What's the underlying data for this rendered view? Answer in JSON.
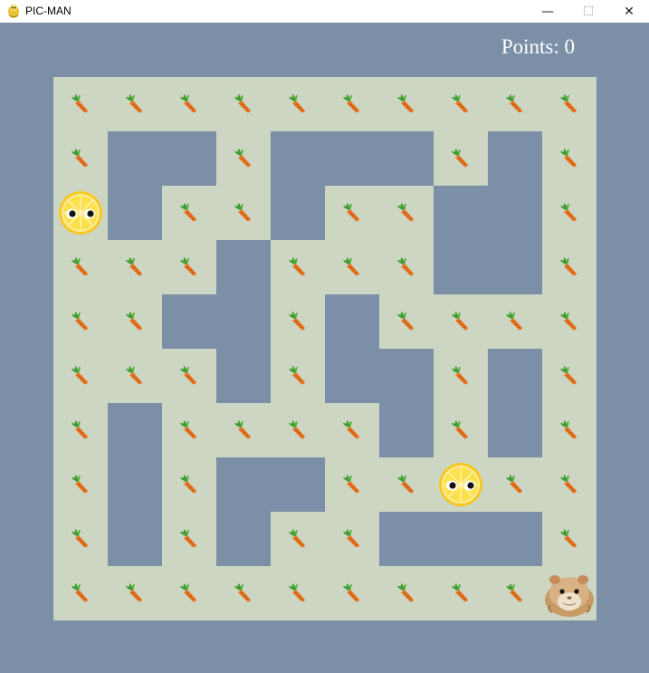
{
  "window": {
    "title": "PIC-MAN",
    "controls": {
      "minimize": "—",
      "maximize": "☐",
      "close": "✕"
    }
  },
  "game": {
    "score_label": "Points: 0",
    "colors": {
      "background": "#7b8fa6",
      "floor": "#ccd6c2",
      "wall": "#7b8fa6"
    },
    "legend": {
      "#": "wall",
      ".": "floor with carrot",
      "L": "lemon ghost",
      "P": "hamster player"
    },
    "maze": [
      "..........",
      ".##.###.#.",
      "L#..#..##.",
      "...#...##.",
      "..##.#....",
      "...#.##.#.",
      ".#....#.#.",
      ".#.##..L..",
      ".#.#..###.",
      ".........P"
    ],
    "sprites": {
      "pellet": "carrot-icon",
      "enemy": "lemon-ghost-icon",
      "player": "hamster-icon"
    }
  }
}
